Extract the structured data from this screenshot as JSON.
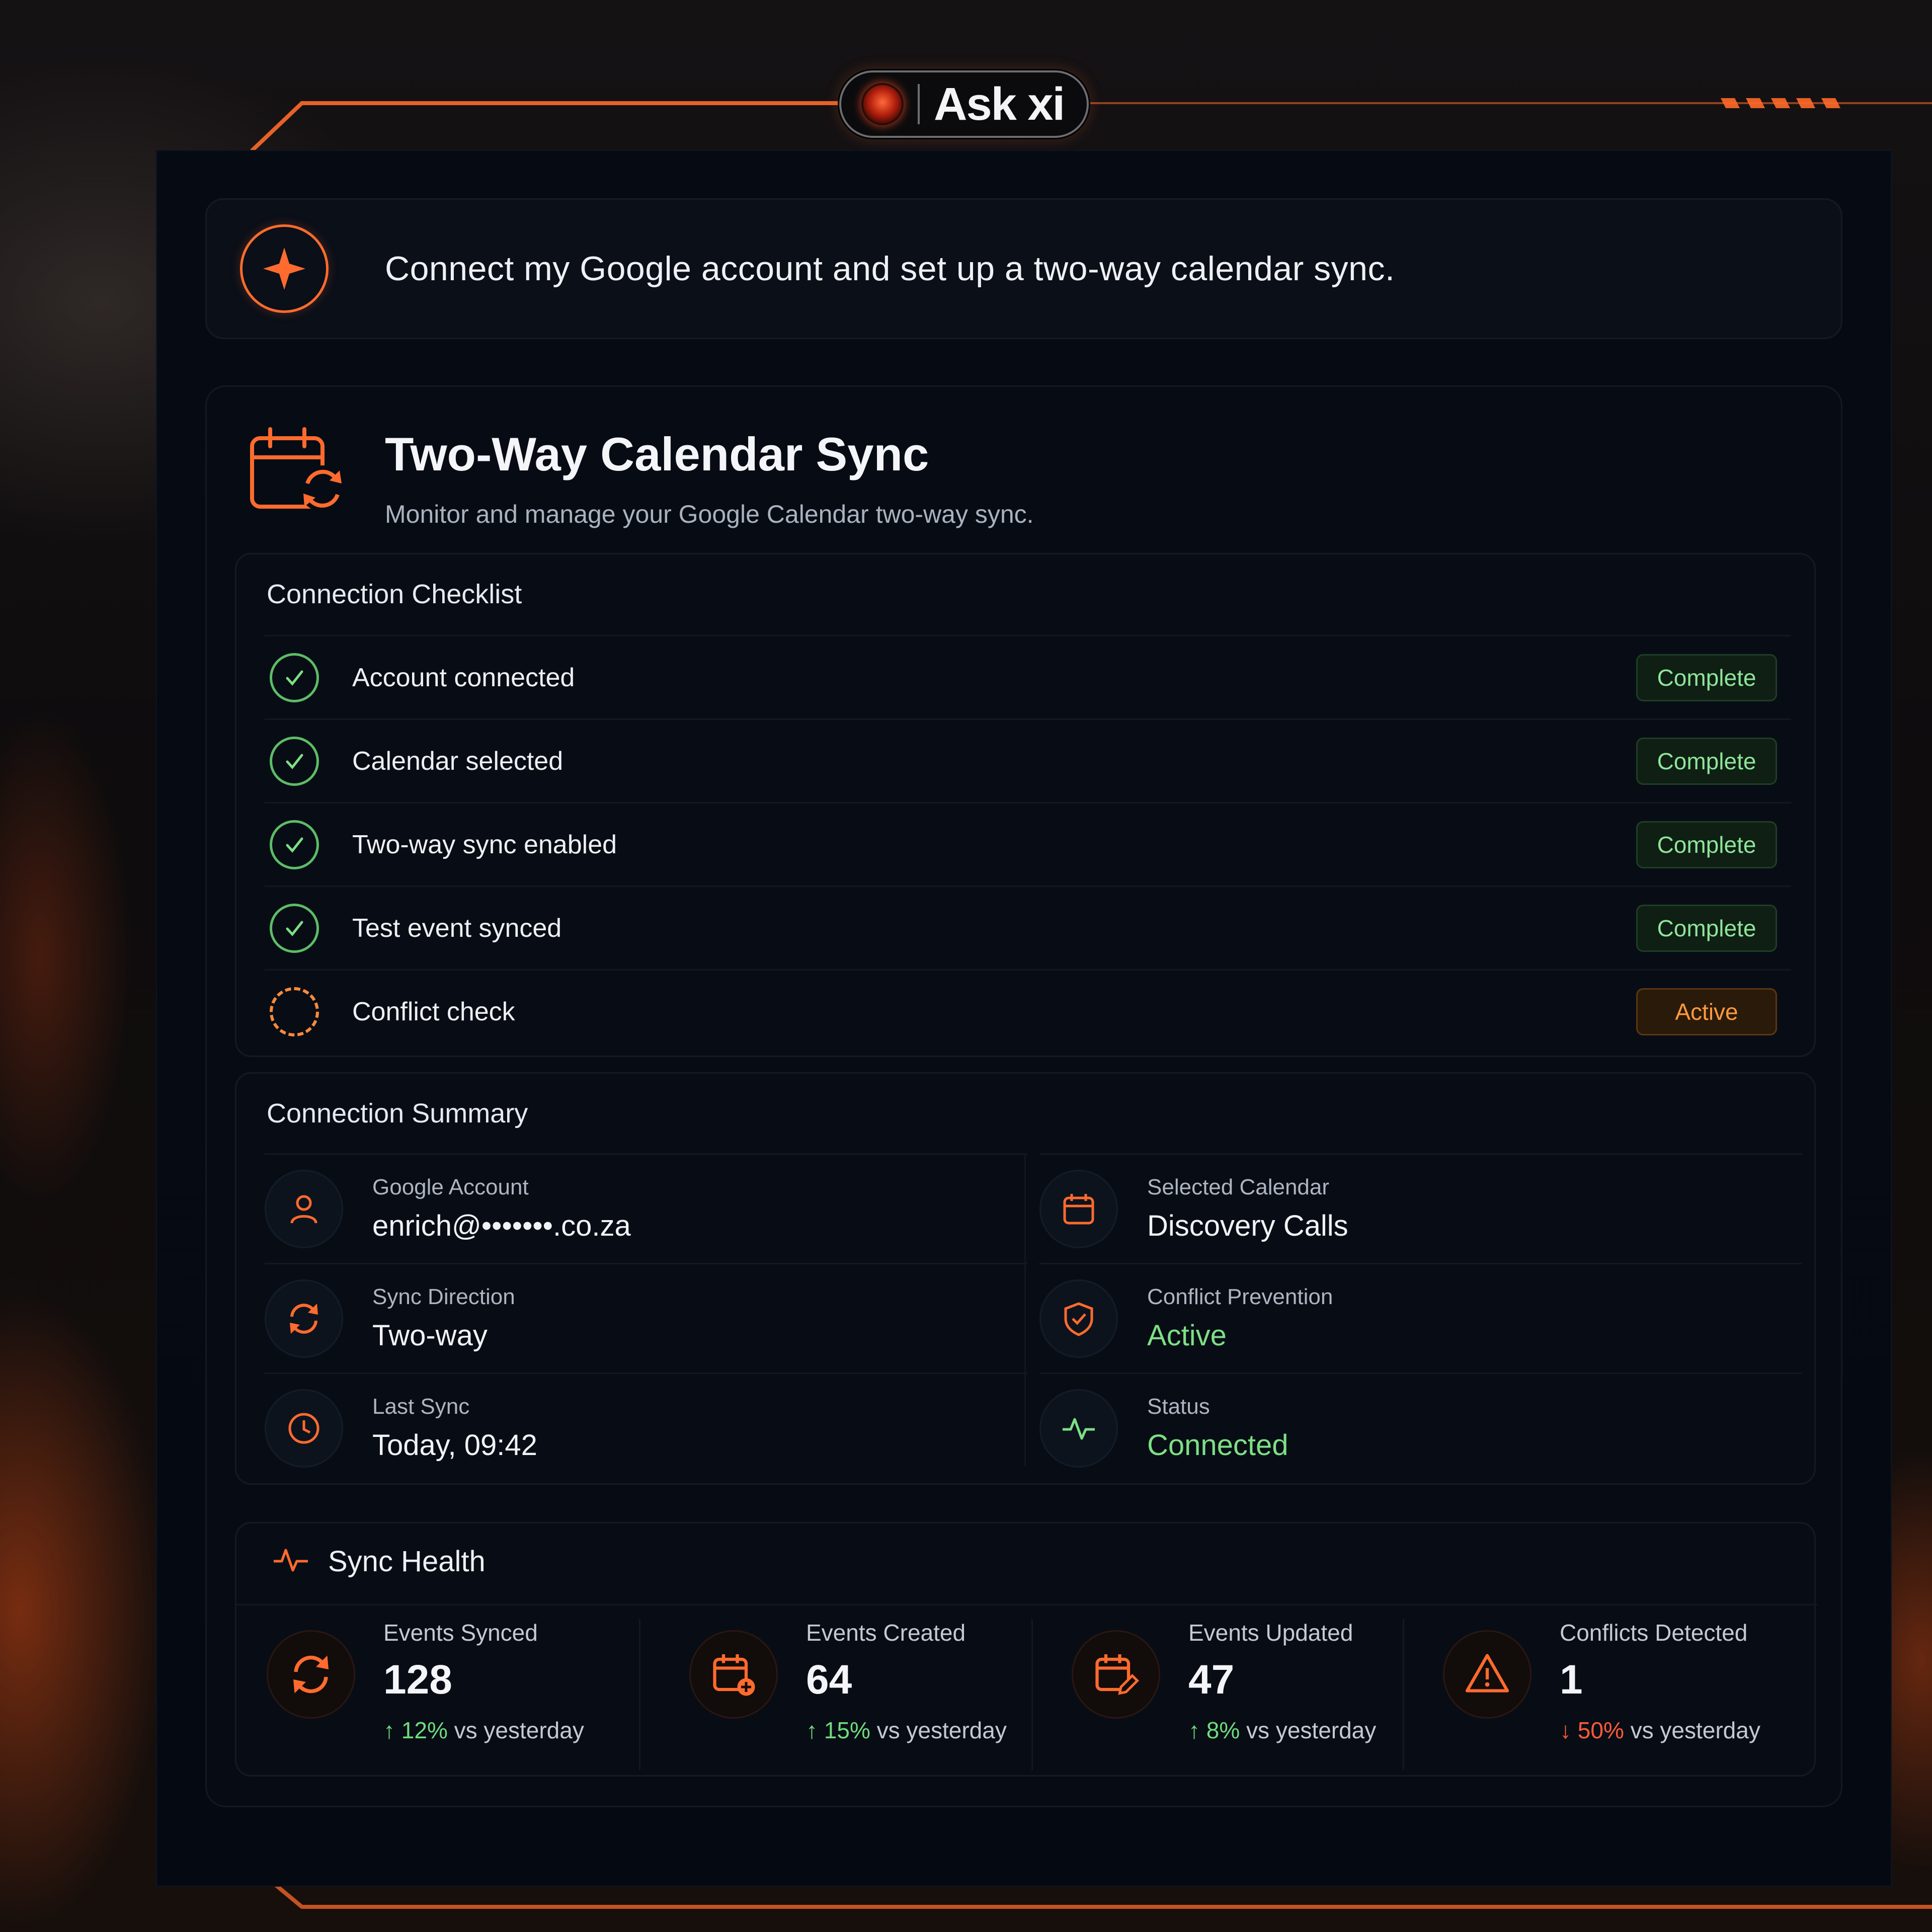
{
  "header": {
    "app_name": "Ask xi"
  },
  "prompt": {
    "text": "Connect my Google account and set up a two-way calendar sync."
  },
  "sync": {
    "title": "Two-Way Calendar Sync",
    "subtitle": "Monitor and manage your Google Calendar two-way sync."
  },
  "checklist": {
    "title": "Connection Checklist",
    "items": [
      {
        "label": "Account connected",
        "status": "Complete"
      },
      {
        "label": "Calendar selected",
        "status": "Complete"
      },
      {
        "label": "Two-way sync enabled",
        "status": "Complete"
      },
      {
        "label": "Test event synced",
        "status": "Complete"
      },
      {
        "label": "Conflict check",
        "status": "Active"
      }
    ]
  },
  "summary": {
    "title": "Connection Summary",
    "items": [
      {
        "label": "Google Account",
        "value": "enrich@•••••••.co.za",
        "icon": "user-icon"
      },
      {
        "label": "Selected Calendar",
        "value": "Discovery Calls",
        "icon": "calendar-icon"
      },
      {
        "label": "Sync Direction",
        "value": "Two-way",
        "icon": "sync-icon"
      },
      {
        "label": "Conflict Prevention",
        "value": "Active",
        "icon": "shield-check-icon"
      },
      {
        "label": "Last Sync",
        "value": "Today, 09:42",
        "icon": "clock-icon"
      },
      {
        "label": "Status",
        "value": "Connected",
        "icon": "activity-icon"
      }
    ]
  },
  "health": {
    "title": "Sync Health",
    "stats": [
      {
        "label": "Events Synced",
        "value": "128",
        "change": "12%",
        "suffix": "vs yesterday",
        "direction": "up"
      },
      {
        "label": "Events Created",
        "value": "64",
        "change": "15%",
        "suffix": "vs yesterday",
        "direction": "up"
      },
      {
        "label": "Events Updated",
        "value": "47",
        "change": "8%",
        "suffix": "vs yesterday",
        "direction": "up"
      },
      {
        "label": "Conflicts Detected",
        "value": "1",
        "change": "50%",
        "suffix": "vs yesterday",
        "direction": "down"
      }
    ]
  },
  "colors": {
    "accent": "#ff6b2e",
    "success": "#7ddf86",
    "warning": "#ff9a3c",
    "danger": "#ff5a3a"
  }
}
